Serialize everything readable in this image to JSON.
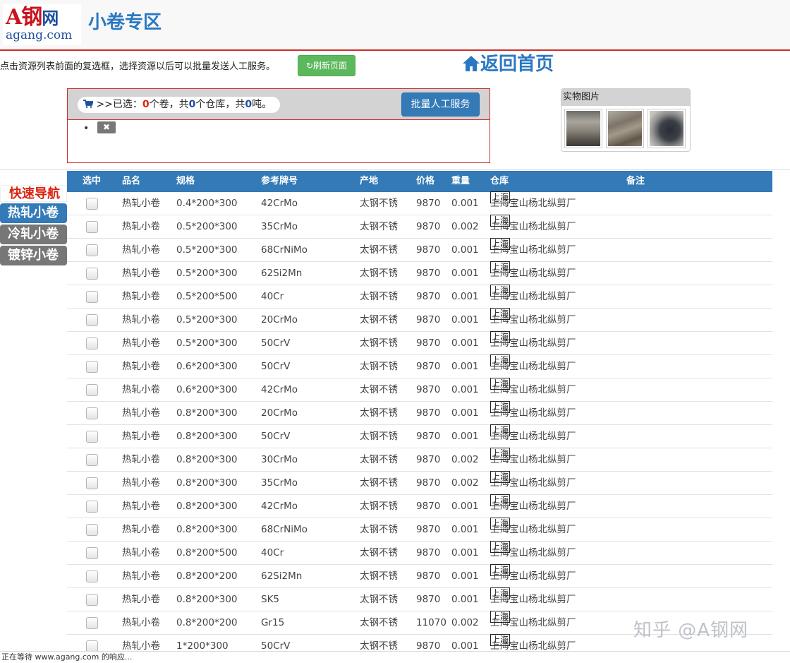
{
  "header": {
    "logo_main": "A钢",
    "logo_net": "网",
    "logo_domain": "agang.com",
    "title": "小卷专区"
  },
  "toolbar": {
    "instruction": "点击资源列表前面的复选框，选择资源以后可以批量发送人工服务。",
    "refresh_label": "刷新页面",
    "home_label": "返回首页"
  },
  "selection": {
    "prefix": ">>已选：",
    "coil_count": "0",
    "coil_unit": "个卷，共",
    "warehouse_count": "0",
    "warehouse_unit": "个仓库，共",
    "ton_count": "0",
    "ton_unit": "吨。",
    "batch_label": "批量人工服务",
    "bullet": "•",
    "remove_label": "✖"
  },
  "photos": {
    "title": "实物图片"
  },
  "quicknav": {
    "title": "快速导航",
    "items": [
      "热轧小卷",
      "冷轧小卷",
      "镀锌小卷"
    ],
    "active_index": 0
  },
  "table": {
    "headers": {
      "select": "选中",
      "name": "品名",
      "spec": "规格",
      "grade": "参考牌号",
      "origin": "产地",
      "price": "价格",
      "weight": "重量",
      "warehouse": "仓库",
      "note": "备注"
    },
    "rows": [
      {
        "name": "热轧小卷",
        "spec": "0.4*200*300",
        "grade": "42CrMo",
        "origin": "太钢不锈",
        "price": "9870",
        "weight": "0.001",
        "city": "上海",
        "warehouse": "上海宝山杨北纵剪厂"
      },
      {
        "name": "热轧小卷",
        "spec": "0.5*200*300",
        "grade": "35CrMo",
        "origin": "太钢不锈",
        "price": "9870",
        "weight": "0.002",
        "city": "上海",
        "warehouse": "上海宝山杨北纵剪厂"
      },
      {
        "name": "热轧小卷",
        "spec": "0.5*200*300",
        "grade": "68CrNiMo",
        "origin": "太钢不锈",
        "price": "9870",
        "weight": "0.001",
        "city": "上海",
        "warehouse": "上海宝山杨北纵剪厂"
      },
      {
        "name": "热轧小卷",
        "spec": "0.5*200*300",
        "grade": "62Si2Mn",
        "origin": "太钢不锈",
        "price": "9870",
        "weight": "0.001",
        "city": "上海",
        "warehouse": "上海宝山杨北纵剪厂"
      },
      {
        "name": "热轧小卷",
        "spec": "0.5*200*500",
        "grade": "40Cr",
        "origin": "太钢不锈",
        "price": "9870",
        "weight": "0.001",
        "city": "上海",
        "warehouse": "上海宝山杨北纵剪厂"
      },
      {
        "name": "热轧小卷",
        "spec": "0.5*200*300",
        "grade": "20CrMo",
        "origin": "太钢不锈",
        "price": "9870",
        "weight": "0.001",
        "city": "上海",
        "warehouse": "上海宝山杨北纵剪厂"
      },
      {
        "name": "热轧小卷",
        "spec": "0.5*200*300",
        "grade": "50CrV",
        "origin": "太钢不锈",
        "price": "9870",
        "weight": "0.001",
        "city": "上海",
        "warehouse": "上海宝山杨北纵剪厂"
      },
      {
        "name": "热轧小卷",
        "spec": "0.6*200*300",
        "grade": "50CrV",
        "origin": "太钢不锈",
        "price": "9870",
        "weight": "0.001",
        "city": "上海",
        "warehouse": "上海宝山杨北纵剪厂"
      },
      {
        "name": "热轧小卷",
        "spec": "0.6*200*300",
        "grade": "42CrMo",
        "origin": "太钢不锈",
        "price": "9870",
        "weight": "0.001",
        "city": "上海",
        "warehouse": "上海宝山杨北纵剪厂"
      },
      {
        "name": "热轧小卷",
        "spec": "0.8*200*300",
        "grade": "20CrMo",
        "origin": "太钢不锈",
        "price": "9870",
        "weight": "0.001",
        "city": "上海",
        "warehouse": "上海宝山杨北纵剪厂"
      },
      {
        "name": "热轧小卷",
        "spec": "0.8*200*300",
        "grade": "50CrV",
        "origin": "太钢不锈",
        "price": "9870",
        "weight": "0.001",
        "city": "上海",
        "warehouse": "上海宝山杨北纵剪厂"
      },
      {
        "name": "热轧小卷",
        "spec": "0.8*200*300",
        "grade": "30CrMo",
        "origin": "太钢不锈",
        "price": "9870",
        "weight": "0.002",
        "city": "上海",
        "warehouse": "上海宝山杨北纵剪厂"
      },
      {
        "name": "热轧小卷",
        "spec": "0.8*200*300",
        "grade": "35CrMo",
        "origin": "太钢不锈",
        "price": "9870",
        "weight": "0.002",
        "city": "上海",
        "warehouse": "上海宝山杨北纵剪厂"
      },
      {
        "name": "热轧小卷",
        "spec": "0.8*200*300",
        "grade": "42CrMo",
        "origin": "太钢不锈",
        "price": "9870",
        "weight": "0.001",
        "city": "上海",
        "warehouse": "上海宝山杨北纵剪厂"
      },
      {
        "name": "热轧小卷",
        "spec": "0.8*200*300",
        "grade": "68CrNiMo",
        "origin": "太钢不锈",
        "price": "9870",
        "weight": "0.001",
        "city": "上海",
        "warehouse": "上海宝山杨北纵剪厂"
      },
      {
        "name": "热轧小卷",
        "spec": "0.8*200*500",
        "grade": "40Cr",
        "origin": "太钢不锈",
        "price": "9870",
        "weight": "0.001",
        "city": "上海",
        "warehouse": "上海宝山杨北纵剪厂"
      },
      {
        "name": "热轧小卷",
        "spec": "0.8*200*200",
        "grade": "62Si2Mn",
        "origin": "太钢不锈",
        "price": "9870",
        "weight": "0.001",
        "city": "上海",
        "warehouse": "上海宝山杨北纵剪厂"
      },
      {
        "name": "热轧小卷",
        "spec": "0.8*200*300",
        "grade": "SK5",
        "origin": "太钢不锈",
        "price": "9870",
        "weight": "0.001",
        "city": "上海",
        "warehouse": "上海宝山杨北纵剪厂"
      },
      {
        "name": "热轧小卷",
        "spec": "0.8*200*200",
        "grade": "Gr15",
        "origin": "太钢不锈",
        "price": "11070",
        "weight": "0.002",
        "city": "上海",
        "warehouse": "上海宝山杨北纵剪厂"
      },
      {
        "name": "热轧小卷",
        "spec": "1*200*300",
        "grade": "50CrV",
        "origin": "太钢不锈",
        "price": "9870",
        "weight": "0.001",
        "city": "上海",
        "warehouse": "上海宝山杨北纵剪厂"
      }
    ]
  },
  "status_bar": {
    "text": "正在等待 www.agang.com 的响应..."
  },
  "watermark": {
    "text": "知乎 @A钢网"
  },
  "colors": {
    "brand_blue": "#337ab7",
    "brand_red": "#c9302c",
    "refresh_green": "#5cb85c",
    "nav_inactive": "#777777"
  }
}
